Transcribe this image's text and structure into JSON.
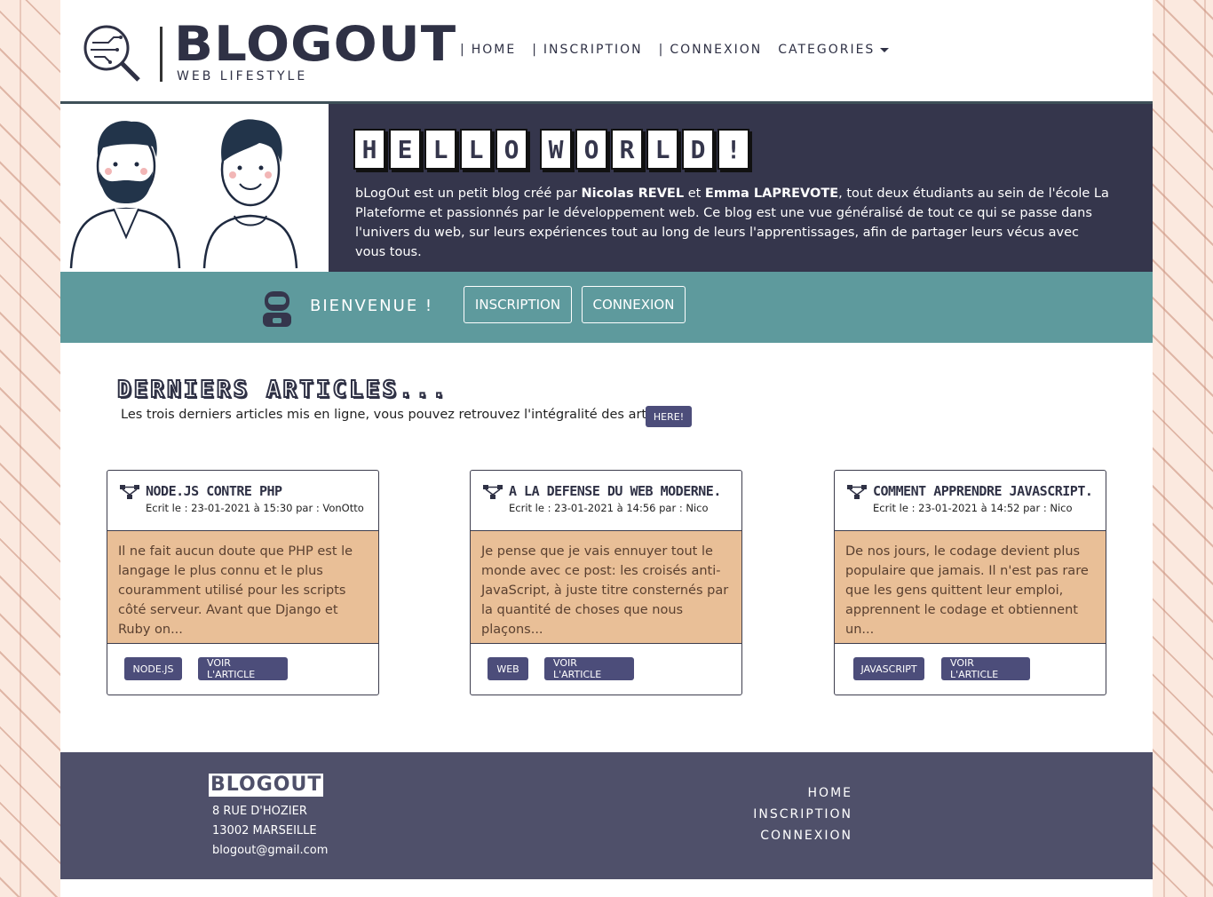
{
  "brand": {
    "title": "BLOGOUT",
    "subtitle": "WEB LIFESTYLE"
  },
  "nav": {
    "home": "HOME",
    "inscription": "INSCRIPTION",
    "connexion": "CONNEXION",
    "categories": "CATEGORIES"
  },
  "hero": {
    "hello_letters": [
      "H",
      "E",
      "L",
      "L",
      "O",
      " ",
      "W",
      "O",
      "R",
      "L",
      "D",
      "!"
    ],
    "intro_1": "bLogOut est un petit blog créé par ",
    "author_1": "Nicolas REVEL",
    "intro_2": " et ",
    "author_2": "Emma LAPREVOTE",
    "intro_3": ", tout deux étudiants au sein de l'école La Plateforme et passionnés par le développement web. Ce blog est une vue généralisé de tout ce qui se passe dans l'univers du web, sur leurs expériences tout au long de leurs l'apprentissages, afin de partager leurs vécus avec vous tous."
  },
  "welcome": {
    "text": "BIENVENUE !",
    "inscription": "INSCRIPTION",
    "connexion": "CONNEXION"
  },
  "articles": {
    "title": "DERNIERS ARTICLES...",
    "subtitle": "Les trois derniers articles mis en ligne, vous pouvez retrouvez l'intégralité des articles",
    "here_button": "HERE!",
    "items": [
      {
        "title": "NODE.JS CONTRE PHP",
        "meta": "Ecrit le : 23-01-2021 à 15:30 par : VonOtto",
        "excerpt": "Il ne fait aucun doute que PHP est le langage le plus connu et le plus couramment utilisé pour les scripts côté serveur. Avant que Django et Ruby on...",
        "tag": "NODE.JS",
        "read": "VOIR L'ARTICLE"
      },
      {
        "title": "A LA DEFENSE DU WEB MODERNE.",
        "meta": "Ecrit le : 23-01-2021 à 14:56 par : Nico",
        "excerpt": "Je pense que je vais ennuyer tout le monde avec ce post: les croisés anti-JavaScript, à juste titre consternés par la quantité de choses que nous plaçons...",
        "tag": "WEB",
        "read": "VOIR L'ARTICLE"
      },
      {
        "title": "COMMENT APPRENDRE JAVASCRIPT.",
        "meta": "Ecrit le : 23-01-2021 à 14:52 par : Nico",
        "excerpt": "De nos jours, le codage devient plus populaire que jamais. Il n'est pas rare que les gens quittent leur emploi, apprennent le codage et obtiennent un...",
        "tag": "JAVASCRIPT",
        "read": "VOIR L'ARTICLE"
      }
    ]
  },
  "footer": {
    "logo": "BLOGOUT",
    "address_1": "8 RUE D'HOZIER",
    "address_2": "13002 MARSEILLE",
    "email": "blogout@gmail.com",
    "links": [
      "HOME",
      "INSCRIPTION",
      "CONNEXION"
    ]
  },
  "colors": {
    "dark_navy": "#35364c",
    "teal": "#5e9a9d",
    "card_tan": "#e9bf97",
    "button_purple": "#4c4d7a",
    "footer_bg": "#4f506a",
    "page_bg_pattern": "#fbe9df"
  }
}
